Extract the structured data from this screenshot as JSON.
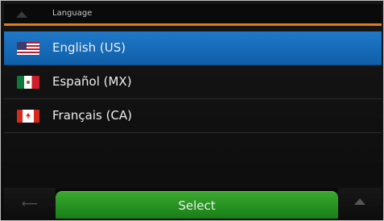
{
  "header": {
    "title": "Language",
    "back_icon": "triangle-up-icon"
  },
  "languages": [
    {
      "label": "English (US)",
      "flag": "us-flag-icon",
      "selected": true
    },
    {
      "label": "Español (MX)",
      "flag": "mx-flag-icon",
      "selected": false
    },
    {
      "label": "Français (CA)",
      "flag": "ca-flag-icon",
      "selected": false
    }
  ],
  "footer": {
    "select_label": "Select",
    "back_icon": "arrow-left-icon",
    "scroll_up_icon": "triangle-up-icon"
  },
  "colors": {
    "accent": "#e07d1e",
    "selected_row": "#1f78c8",
    "select_button": "#2f9a26"
  }
}
